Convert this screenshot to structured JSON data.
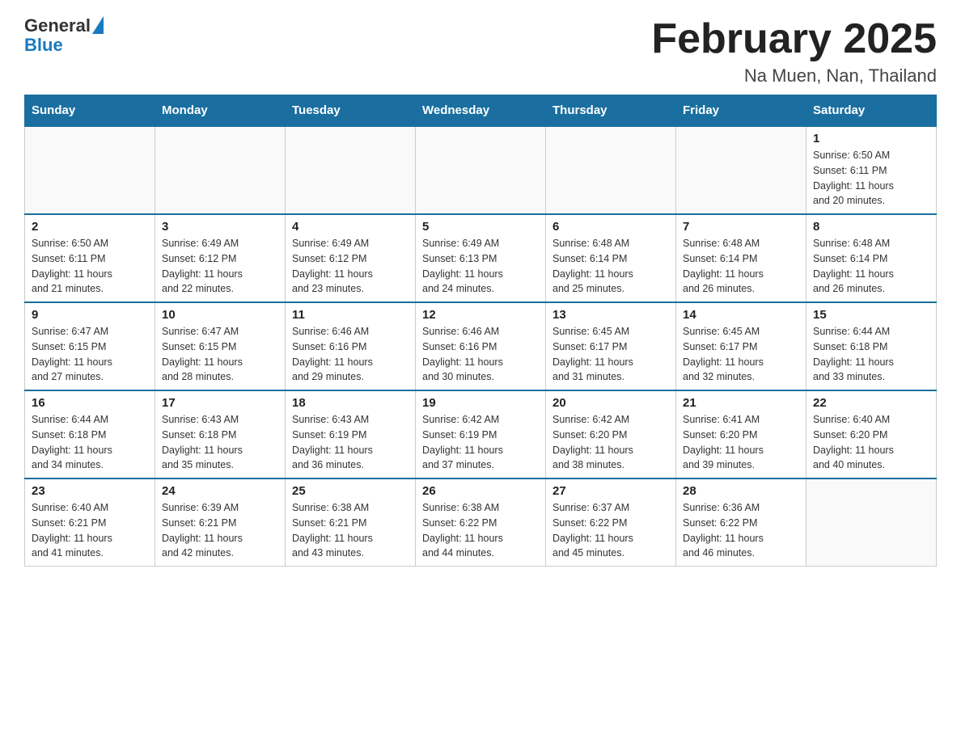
{
  "header": {
    "logo_general": "General",
    "logo_blue": "Blue",
    "month_title": "February 2025",
    "location": "Na Muen, Nan, Thailand"
  },
  "days_of_week": [
    "Sunday",
    "Monday",
    "Tuesday",
    "Wednesday",
    "Thursday",
    "Friday",
    "Saturday"
  ],
  "weeks": [
    [
      {
        "day": "",
        "info": ""
      },
      {
        "day": "",
        "info": ""
      },
      {
        "day": "",
        "info": ""
      },
      {
        "day": "",
        "info": ""
      },
      {
        "day": "",
        "info": ""
      },
      {
        "day": "",
        "info": ""
      },
      {
        "day": "1",
        "info": "Sunrise: 6:50 AM\nSunset: 6:11 PM\nDaylight: 11 hours\nand 20 minutes."
      }
    ],
    [
      {
        "day": "2",
        "info": "Sunrise: 6:50 AM\nSunset: 6:11 PM\nDaylight: 11 hours\nand 21 minutes."
      },
      {
        "day": "3",
        "info": "Sunrise: 6:49 AM\nSunset: 6:12 PM\nDaylight: 11 hours\nand 22 minutes."
      },
      {
        "day": "4",
        "info": "Sunrise: 6:49 AM\nSunset: 6:12 PM\nDaylight: 11 hours\nand 23 minutes."
      },
      {
        "day": "5",
        "info": "Sunrise: 6:49 AM\nSunset: 6:13 PM\nDaylight: 11 hours\nand 24 minutes."
      },
      {
        "day": "6",
        "info": "Sunrise: 6:48 AM\nSunset: 6:14 PM\nDaylight: 11 hours\nand 25 minutes."
      },
      {
        "day": "7",
        "info": "Sunrise: 6:48 AM\nSunset: 6:14 PM\nDaylight: 11 hours\nand 26 minutes."
      },
      {
        "day": "8",
        "info": "Sunrise: 6:48 AM\nSunset: 6:14 PM\nDaylight: 11 hours\nand 26 minutes."
      }
    ],
    [
      {
        "day": "9",
        "info": "Sunrise: 6:47 AM\nSunset: 6:15 PM\nDaylight: 11 hours\nand 27 minutes."
      },
      {
        "day": "10",
        "info": "Sunrise: 6:47 AM\nSunset: 6:15 PM\nDaylight: 11 hours\nand 28 minutes."
      },
      {
        "day": "11",
        "info": "Sunrise: 6:46 AM\nSunset: 6:16 PM\nDaylight: 11 hours\nand 29 minutes."
      },
      {
        "day": "12",
        "info": "Sunrise: 6:46 AM\nSunset: 6:16 PM\nDaylight: 11 hours\nand 30 minutes."
      },
      {
        "day": "13",
        "info": "Sunrise: 6:45 AM\nSunset: 6:17 PM\nDaylight: 11 hours\nand 31 minutes."
      },
      {
        "day": "14",
        "info": "Sunrise: 6:45 AM\nSunset: 6:17 PM\nDaylight: 11 hours\nand 32 minutes."
      },
      {
        "day": "15",
        "info": "Sunrise: 6:44 AM\nSunset: 6:18 PM\nDaylight: 11 hours\nand 33 minutes."
      }
    ],
    [
      {
        "day": "16",
        "info": "Sunrise: 6:44 AM\nSunset: 6:18 PM\nDaylight: 11 hours\nand 34 minutes."
      },
      {
        "day": "17",
        "info": "Sunrise: 6:43 AM\nSunset: 6:18 PM\nDaylight: 11 hours\nand 35 minutes."
      },
      {
        "day": "18",
        "info": "Sunrise: 6:43 AM\nSunset: 6:19 PM\nDaylight: 11 hours\nand 36 minutes."
      },
      {
        "day": "19",
        "info": "Sunrise: 6:42 AM\nSunset: 6:19 PM\nDaylight: 11 hours\nand 37 minutes."
      },
      {
        "day": "20",
        "info": "Sunrise: 6:42 AM\nSunset: 6:20 PM\nDaylight: 11 hours\nand 38 minutes."
      },
      {
        "day": "21",
        "info": "Sunrise: 6:41 AM\nSunset: 6:20 PM\nDaylight: 11 hours\nand 39 minutes."
      },
      {
        "day": "22",
        "info": "Sunrise: 6:40 AM\nSunset: 6:20 PM\nDaylight: 11 hours\nand 40 minutes."
      }
    ],
    [
      {
        "day": "23",
        "info": "Sunrise: 6:40 AM\nSunset: 6:21 PM\nDaylight: 11 hours\nand 41 minutes."
      },
      {
        "day": "24",
        "info": "Sunrise: 6:39 AM\nSunset: 6:21 PM\nDaylight: 11 hours\nand 42 minutes."
      },
      {
        "day": "25",
        "info": "Sunrise: 6:38 AM\nSunset: 6:21 PM\nDaylight: 11 hours\nand 43 minutes."
      },
      {
        "day": "26",
        "info": "Sunrise: 6:38 AM\nSunset: 6:22 PM\nDaylight: 11 hours\nand 44 minutes."
      },
      {
        "day": "27",
        "info": "Sunrise: 6:37 AM\nSunset: 6:22 PM\nDaylight: 11 hours\nand 45 minutes."
      },
      {
        "day": "28",
        "info": "Sunrise: 6:36 AM\nSunset: 6:22 PM\nDaylight: 11 hours\nand 46 minutes."
      },
      {
        "day": "",
        "info": ""
      }
    ]
  ]
}
